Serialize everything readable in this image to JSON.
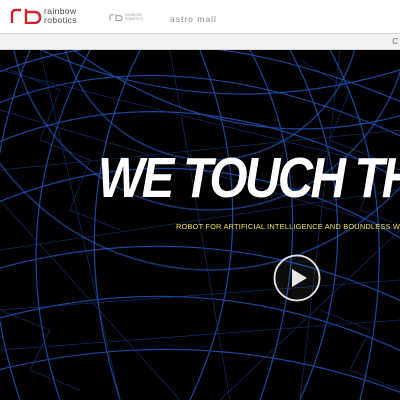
{
  "header": {
    "brand_line1": "rainbow",
    "brand_line2": "robotics",
    "brand_color": "#d2232a",
    "sub_brand_text": "RAINBOW ROBOTICS",
    "astro_label": "astro mall"
  },
  "subbar": {
    "link_label": "C"
  },
  "hero": {
    "headline": "WE TOUCH THE C",
    "tagline": "ROBOT FOR ARTIFICIAL INTELLIGENCE AND BOUNDLESS WAL",
    "tagline_color": "#f2e04a",
    "wire_color": "#1e4fb0",
    "play_icon": "play-icon"
  }
}
